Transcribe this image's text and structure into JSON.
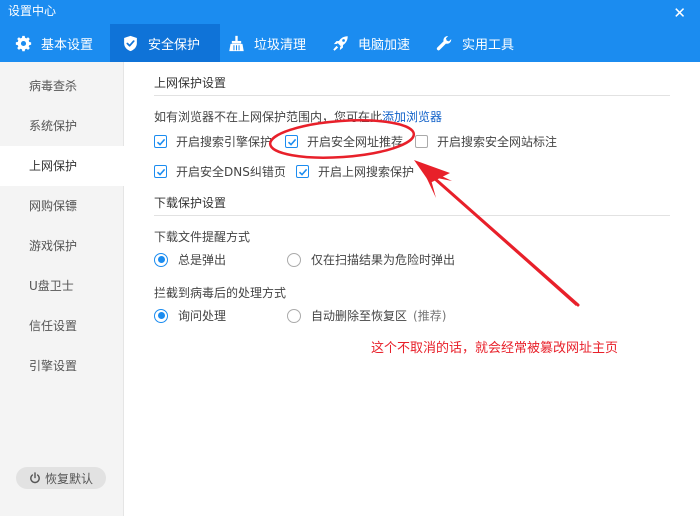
{
  "window": {
    "title": "设置中心",
    "close_label": "✕"
  },
  "tabs": [
    {
      "label": "基本设置",
      "icon": "gear-icon"
    },
    {
      "label": "安全保护",
      "icon": "shield-icon",
      "active": true
    },
    {
      "label": "垃圾清理",
      "icon": "broom-icon"
    },
    {
      "label": "电脑加速",
      "icon": "rocket-icon"
    },
    {
      "label": "实用工具",
      "icon": "wrench-icon"
    }
  ],
  "sidebar": {
    "items": [
      {
        "label": "病毒查杀"
      },
      {
        "label": "系统保护"
      },
      {
        "label": "上网保护",
        "active": true
      },
      {
        "label": "网购保镖"
      },
      {
        "label": "游戏保护"
      },
      {
        "label": "U盘卫士"
      },
      {
        "label": "信任设置"
      },
      {
        "label": "引擎设置"
      }
    ],
    "restore_label": "恢复默认"
  },
  "web_protection": {
    "title": "上网保护设置",
    "hint": "如有浏览器不在上网保护范围内，您可在此",
    "add_browser_link": "添加浏览器",
    "options": [
      {
        "label": "开启搜索引擎保护",
        "checked": true
      },
      {
        "label": "开启安全网址推荐",
        "checked": true
      },
      {
        "label": "开启搜索安全网站标注",
        "checked": false
      },
      {
        "label": "开启安全DNS纠错页",
        "checked": true
      },
      {
        "label": "开启上网搜索保护",
        "checked": true
      }
    ]
  },
  "download_protection": {
    "title": "下载保护设置",
    "reminder_label": "下载文件提醒方式",
    "reminder_options": [
      {
        "label": "总是弹出",
        "selected": true
      },
      {
        "label": "仅在扫描结果为危险时弹出",
        "selected": false
      }
    ],
    "virus_label": "拦截到病毒后的处理方式",
    "virus_options": [
      {
        "label": "询问处理",
        "selected": true
      },
      {
        "label": "自动删除至恢复区",
        "suffix": "(推荐)",
        "selected": false
      }
    ]
  },
  "annotation": {
    "text": "这个不取消的话，就会经常被篡改网址主页",
    "color": "#e8202a"
  },
  "colors": {
    "header": "#1b8cf0",
    "active_tab": "#0f73d8",
    "accent": "#1b8cf0"
  }
}
